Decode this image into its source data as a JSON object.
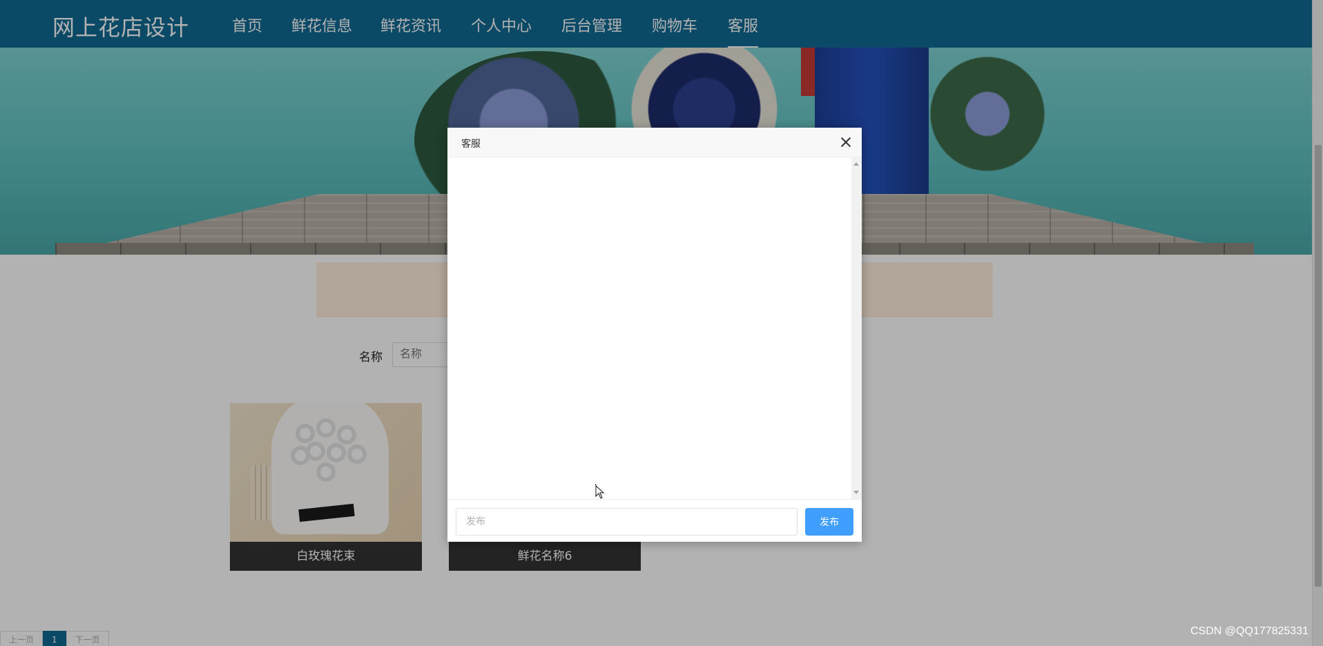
{
  "site": {
    "brand": "网上花店设计",
    "nav": [
      {
        "label": "首页",
        "active": false
      },
      {
        "label": "鲜花信息",
        "active": false
      },
      {
        "label": "鲜花资讯",
        "active": false
      },
      {
        "label": "个人中心",
        "active": false
      },
      {
        "label": "后台管理",
        "active": false
      },
      {
        "label": "购物车",
        "active": false
      },
      {
        "label": "客服",
        "active": true
      }
    ]
  },
  "search": {
    "label": "名称",
    "placeholder": "名称"
  },
  "products": [
    {
      "title": "白玫瑰花束"
    },
    {
      "title": "鲜花名称6"
    }
  ],
  "pagination": {
    "prev": "上一页",
    "current": "1",
    "next": "下一页"
  },
  "modal": {
    "title": "客服",
    "input_placeholder": "发布",
    "send_label": "发布"
  },
  "watermark": "CSDN @QQ177825331",
  "colors": {
    "navbar": "#0f6a94",
    "send_button": "#409eff",
    "card_caption": "#333333"
  }
}
